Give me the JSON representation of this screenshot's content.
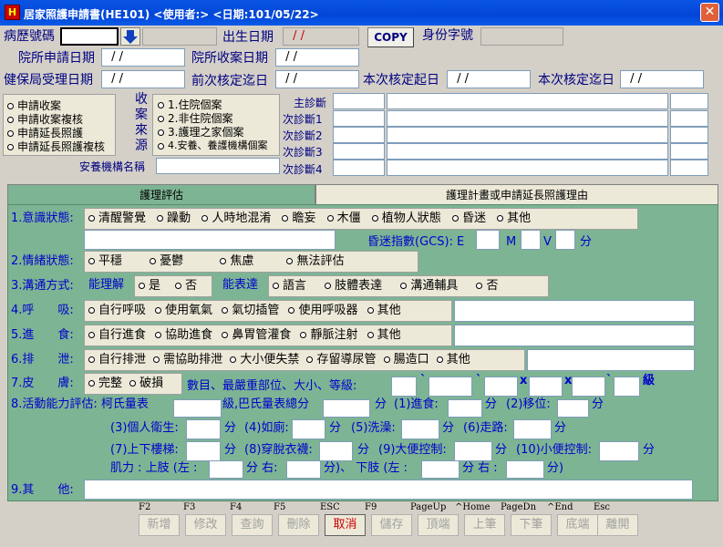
{
  "window": {
    "title": "居家照護申請書(HE101)   <使用者:>    <日期:101/05/22>",
    "close_label": "✕",
    "icon_label": "H"
  },
  "header": {
    "chart_no_label": "病歷號碼",
    "birth_label": "出生日期",
    "birth_value": " / /",
    "copy_label": "COPY",
    "id_label": "身份字號",
    "hosp_apply_label": "院所申請日期",
    "hosp_apply_value": " / /",
    "hosp_recv_label": "院所收案日期",
    "hosp_recv_value": " / /",
    "nhi_recv_label": "健保局受理日期",
    "nhi_recv_value": " / /",
    "prev_end_label": "前次核定迄日",
    "prev_end_value": " / /",
    "cur_start_label": "本次核定起日",
    "cur_start_value": " / /",
    "cur_end_label": "本次核定迄日",
    "cur_end_value": " / /"
  },
  "apply_types": [
    "申請收案",
    "申請收案複核",
    "申請延長照護",
    "申請延長照護複核"
  ],
  "source": {
    "label_chars": [
      "收",
      "案",
      "來",
      "源"
    ],
    "options": [
      "1.住院個案",
      "2.非住院個案",
      "3.護理之家個案",
      "4.安養、養護機構個案"
    ]
  },
  "diagnosis": {
    "labels": [
      "主診斷",
      "次診斷1",
      "次診斷2",
      "次診斷3",
      "次診斷4"
    ]
  },
  "institution_label": "安養機構名稱",
  "tabs": [
    "護理評估",
    "護理計畫或申請延長照護理由"
  ],
  "assessment": {
    "consciousness": {
      "label": "1.意識狀態:",
      "options": [
        "清醒警覺",
        "躁動",
        "人時地混淆",
        "瞻妄",
        "木僵",
        "植物人狀態",
        "昏迷",
        "其他"
      ],
      "gcs_label": "昏迷指數(GCS): E",
      "gcs_m": "M",
      "gcs_v": "V",
      "gcs_unit": "分"
    },
    "emotion": {
      "label": "2.情緒狀態:",
      "options": [
        "平穩",
        "憂鬱",
        "焦慮",
        "無法評估"
      ]
    },
    "communication": {
      "label": "3.溝通方式:",
      "understand_label": "能理解",
      "understand_options": [
        "是",
        "否"
      ],
      "express_label": "能表達",
      "express_options": [
        "語言",
        "肢體表達",
        "溝通輔具",
        "否"
      ]
    },
    "breathing": {
      "label": "4.呼　　吸:",
      "options": [
        "自行呼吸",
        "使用氧氣",
        "氣切插管",
        "使用呼吸器",
        "其他"
      ]
    },
    "feeding": {
      "label": "5.進　　食:",
      "options": [
        "自行進食",
        "協助進食",
        "鼻胃管灌食",
        "靜脈注射",
        "其他"
      ]
    },
    "excretion": {
      "label": "6.排　　泄:",
      "options": [
        "自行排泄",
        "需協助排泄",
        "大小便失禁",
        "存留導尿管",
        "腸造口",
        "其他"
      ]
    },
    "skin": {
      "label": "7.皮　　膚:",
      "options": [
        "完整",
        "破損"
      ],
      "detail_label": "數目、最嚴重部位、大小、等級:",
      "sep1": "`",
      "sep2": "`",
      "x1": "x",
      "x2": "x",
      "sep3": "`",
      "grade": "級"
    },
    "activity": {
      "label": "8.活動能力評估: 柯氏量表",
      "kirk_grade": "級,巴氏量表總分",
      "unit": "分",
      "items": [
        "(1)進食:",
        "(2)移位:",
        "(3)個人衛生:",
        "(4)如廁:",
        "(5)洗澡:",
        "(6)走路:",
        "(7)上下樓梯:",
        "(8)穿脫衣襪:",
        "(9)大便控制:",
        "(10)小便控制:"
      ],
      "muscle_label": "肌力 : 上肢 (左 :",
      "right_label": "分  右:",
      "lower_label": "分)、   下肢 (左 :",
      "lower_right": "分  右 :",
      "end_label": "分)"
    },
    "other_label": "9.其　　他:"
  },
  "footer": {
    "keys": [
      "F2",
      "F3",
      "F4",
      "F5",
      "ESC",
      "F9",
      "PageUp",
      "^Home",
      "PageDn",
      "^End",
      "Esc"
    ],
    "buttons": [
      "新增",
      "修改",
      "查詢",
      "刪除",
      "取消",
      "儲存",
      "頂端",
      "上筆",
      "下筆",
      "底端",
      "離開"
    ]
  }
}
